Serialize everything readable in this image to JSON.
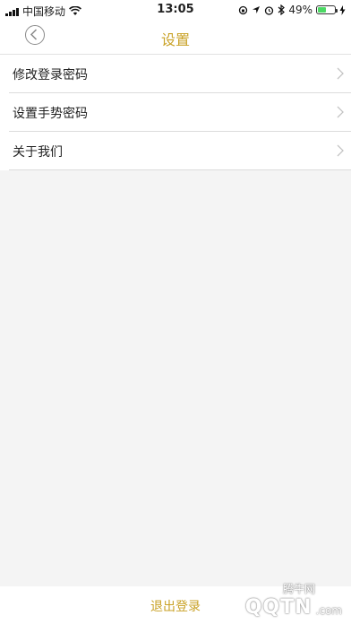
{
  "status_bar": {
    "carrier": "中国移动",
    "time": "13:05",
    "battery_percent": "49%",
    "battery_level": 0.49,
    "icons": [
      "signal-icon",
      "wifi-icon",
      "location-icon",
      "alarm-icon",
      "bluetooth-icon",
      "battery-icon",
      "charging-icon"
    ]
  },
  "nav": {
    "title": "设置",
    "back_icon": "chevron-left-icon"
  },
  "menu": {
    "items": [
      {
        "label": "修改登录密码"
      },
      {
        "label": "设置手势密码"
      },
      {
        "label": "关于我们"
      }
    ]
  },
  "footer": {
    "logout_label": "退出登录"
  },
  "watermark": {
    "site_name": "腾牛网",
    "brand": "QQTN",
    "domain_suffix": ".com"
  },
  "colors": {
    "accent": "#c9a227",
    "background": "#f4f4f4",
    "battery": "#4cd964"
  }
}
